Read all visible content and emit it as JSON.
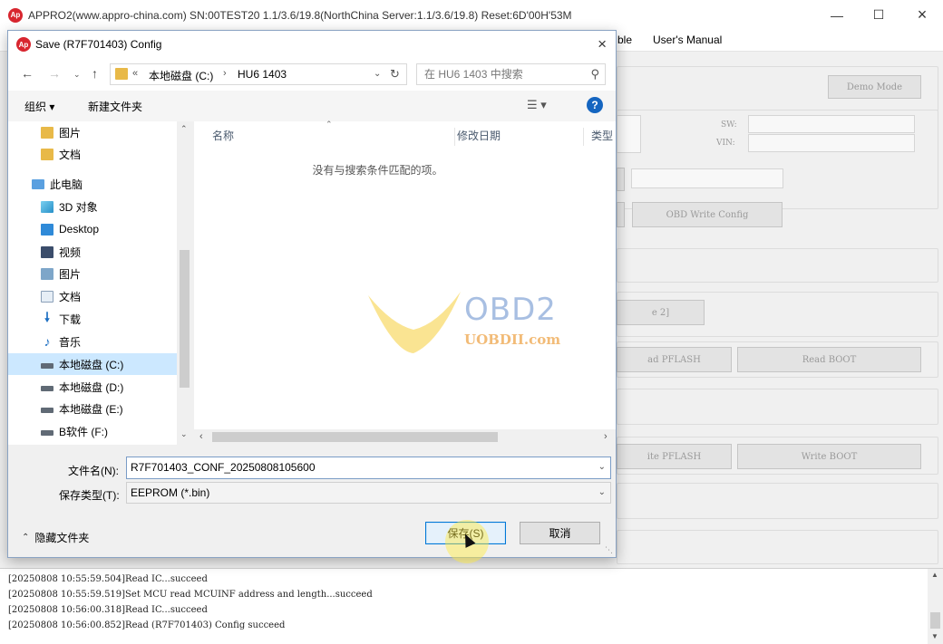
{
  "app": {
    "title": "APPRO2(www.appro-china.com)  SN:00TEST20  1.1/3.6/19.8(NorthChina Server:1.1/3.6/19.8)  Reset:6D'00H'53M",
    "logo_text": "Ap",
    "menu": [
      "ble",
      "User's Manual"
    ],
    "buttons": {
      "demo_mode": "Demo Mode",
      "obd_write_config": "OBD Write Config",
      "param2": "e 2]",
      "read_pflash": "ad PFLASH",
      "read_boot": "Read BOOT",
      "write_pflash": "ite PFLASH",
      "write_boot": "Write BOOT"
    },
    "labels": {
      "sw": "SW:",
      "vin": "VIN:"
    }
  },
  "dialog": {
    "title": "Save (R7F701403) Config",
    "logo_text": "Ap",
    "address": {
      "chevrons": "«",
      "crumb_1": "本地磁盘 (C:)",
      "separator": "›",
      "crumb_2": "HU6 1403"
    },
    "search": {
      "placeholder": "在 HU6 1403 中搜索"
    },
    "toolbar": {
      "organize": "组织 ▾",
      "new_folder": "新建文件夹"
    },
    "nav_tree": [
      {
        "label": "图片",
        "icon": "folder-icon"
      },
      {
        "label": "文档",
        "icon": "folder-icon"
      },
      {
        "label": "此电脑",
        "icon": "pc-icon"
      },
      {
        "label": "3D 对象",
        "icon": "3d-objects-icon"
      },
      {
        "label": "Desktop",
        "icon": "desktop-icon"
      },
      {
        "label": "视频",
        "icon": "video-icon"
      },
      {
        "label": "图片",
        "icon": "picture-icon"
      },
      {
        "label": "文档",
        "icon": "document-icon"
      },
      {
        "label": "下载",
        "icon": "download-icon"
      },
      {
        "label": "音乐",
        "icon": "music-icon"
      },
      {
        "label": "本地磁盘 (C:)",
        "icon": "drive-icon"
      },
      {
        "label": "本地磁盘 (D:)",
        "icon": "drive-icon"
      },
      {
        "label": "本地磁盘 (E:)",
        "icon": "drive-icon"
      },
      {
        "label": "B软件 (F:)",
        "icon": "drive-icon"
      }
    ],
    "columns": {
      "name": "名称",
      "date": "修改日期",
      "type": "类型"
    },
    "empty_message": "没有与搜索条件匹配的项。",
    "filename_label": "文件名(N):",
    "filename_value": "R7F701403_CONF_20250808105600",
    "filetype_label": "保存类型(T):",
    "filetype_value": "EEPROM (*.bin)",
    "hide_folders": "隐藏文件夹",
    "save_label": "保存(S)",
    "cancel_label": "取消"
  },
  "watermark": {
    "brand": "OBD2",
    "site": "UOBDII.com"
  },
  "log": [
    "[20250808 10:55:59.504]Read IC...succeed",
    "[20250808 10:55:59.519]Set MCU read MCUINF address and length...succeed",
    "[20250808 10:56:00.318]Read IC...succeed",
    "[20250808 10:56:00.852]Read (R7F701403) Config succeed"
  ]
}
